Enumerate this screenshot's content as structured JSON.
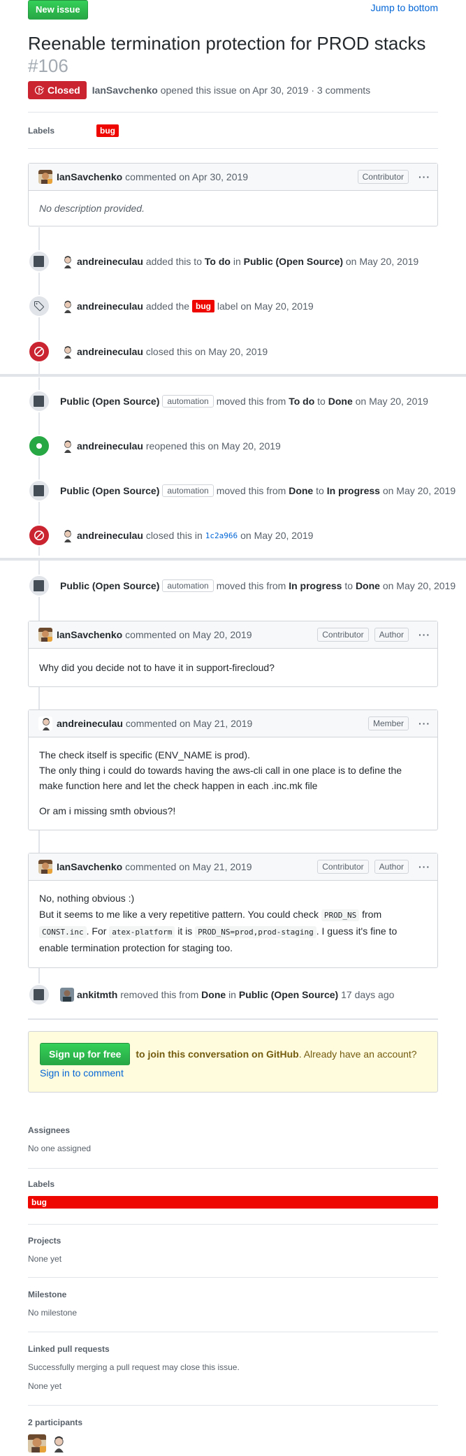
{
  "header": {
    "new_issue": "New issue",
    "jump": "Jump to bottom"
  },
  "issue": {
    "title": "Reenable termination protection for PROD stacks",
    "number": "#106",
    "state": "Closed",
    "author": "IanSavchenko",
    "opened_text": "opened this issue on Apr 30, 2019 · 3 comments"
  },
  "labels_row": {
    "title": "Labels",
    "label": "bug"
  },
  "comment1": {
    "author": "IanSavchenko",
    "action": "commented on Apr 30, 2019",
    "role": "Contributor",
    "body": "No description provided."
  },
  "events": {
    "e1": {
      "actor": "andreineculau",
      "t1": "added this to",
      "col": "To do",
      "t2": "in",
      "project": "Public (Open Source)",
      "date": "on May 20, 2019"
    },
    "e2": {
      "actor": "andreineculau",
      "t1": "added the",
      "label": "bug",
      "t2": "label on May 20, 2019"
    },
    "e3": {
      "actor": "andreineculau",
      "t1": "closed this on May 20, 2019"
    },
    "e4": {
      "project": "Public (Open Source)",
      "badge": "automation",
      "t1": "moved this from",
      "from": "To do",
      "t2": "to",
      "to": "Done",
      "date": "on May 20, 2019"
    },
    "e5": {
      "actor": "andreineculau",
      "t1": "reopened this on May 20, 2019"
    },
    "e6": {
      "project": "Public (Open Source)",
      "badge": "automation",
      "t1": "moved this from",
      "from": "Done",
      "t2": "to",
      "to": "In progress",
      "date": "on May 20, 2019"
    },
    "e7": {
      "actor": "andreineculau",
      "t1": "closed this in",
      "sha": "1c2a966",
      "date": "on May 20, 2019"
    },
    "e8": {
      "project": "Public (Open Source)",
      "badge": "automation",
      "t1": "moved this from",
      "from": "In progress",
      "t2": "to",
      "to": "Done",
      "date": "on May 20, 2019"
    },
    "e9": {
      "actor": "ankitmth",
      "t1": "removed this from",
      "col": "Done",
      "t2": "in",
      "project": "Public (Open Source)",
      "date": "17 days ago"
    }
  },
  "comment2": {
    "author": "IanSavchenko",
    "action": "commented on May 20, 2019",
    "role1": "Contributor",
    "role2": "Author",
    "body": "Why did you decide not to have it in support-firecloud?"
  },
  "comment3": {
    "author": "andreineculau",
    "action": "commented on May 21, 2019",
    "role": "Member",
    "p1a": "The check itself is specific (ENV_NAME is prod).",
    "p1b": "The only thing i could do towards having the aws-cli call in one place is to define the make function here and let the check happen in each .inc.mk file",
    "p2": "Or am i missing smth obvious?!"
  },
  "comment4": {
    "author": "IanSavchenko",
    "action": "commented on May 21, 2019",
    "role1": "Contributor",
    "role2": "Author",
    "l1": "No, nothing obvious :)",
    "l2a": "But it seems to me like a very repetitive pattern. You could check",
    "c1": "PROD_NS",
    "l2b": "from",
    "c2": "CONST.inc",
    "l2c": ". For",
    "c3": "atex-platform",
    "l2d": "it is",
    "c4": "PROD_NS=prod,prod-staging",
    "l2e": ". I guess it's fine to enable termination protection for staging too."
  },
  "signup": {
    "button": "Sign up for free",
    "bold": "to join this conversation on GitHub",
    "rest": ". Already have an account?",
    "link": "Sign in to comment"
  },
  "sidebar": {
    "assignees_h": "Assignees",
    "assignees_v": "No one assigned",
    "labels_h": "Labels",
    "labels_v": "bug",
    "projects_h": "Projects",
    "projects_v": "None yet",
    "milestone_h": "Milestone",
    "milestone_v": "No milestone",
    "linked_h": "Linked pull requests",
    "linked_note": "Successfully merging a pull request may close this issue.",
    "linked_v": "None yet",
    "participants_h": "2 participants"
  },
  "colors": {
    "green": "#28a745",
    "red": "#cb2431",
    "bug": "#ee0701",
    "link": "#0366d6"
  }
}
